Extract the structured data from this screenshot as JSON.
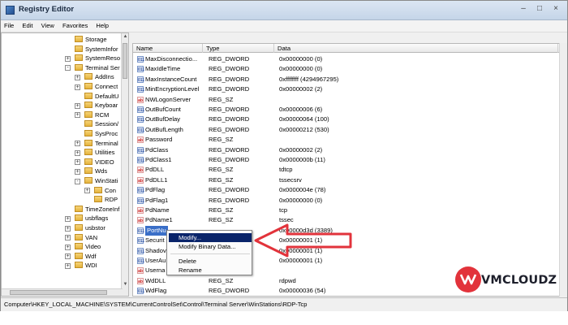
{
  "window": {
    "title": "Registry Editor"
  },
  "menu": [
    "File",
    "Edit",
    "View",
    "Favorites",
    "Help"
  ],
  "tree": [
    {
      "label": "Storage",
      "depth": 3
    },
    {
      "label": "SystemInfor",
      "depth": 3
    },
    {
      "label": "SystemReso",
      "depth": 3,
      "expand": "+"
    },
    {
      "label": "Terminal Ser",
      "depth": 3,
      "expand": "-"
    },
    {
      "label": "AddIns",
      "depth": 4,
      "expand": "+"
    },
    {
      "label": "Connect",
      "depth": 4,
      "expand": "+"
    },
    {
      "label": "DefaultU",
      "depth": 4
    },
    {
      "label": "Keyboar",
      "depth": 4,
      "expand": "+"
    },
    {
      "label": "RCM",
      "depth": 4,
      "expand": "+"
    },
    {
      "label": "Session/",
      "depth": 4
    },
    {
      "label": "SysProc",
      "depth": 4
    },
    {
      "label": "Terminal",
      "depth": 4,
      "expand": "+"
    },
    {
      "label": "Utilities",
      "depth": 4,
      "expand": "+"
    },
    {
      "label": "VIDEO",
      "depth": 4,
      "expand": "+"
    },
    {
      "label": "Wds",
      "depth": 4,
      "expand": "+"
    },
    {
      "label": "WinStati",
      "depth": 4,
      "expand": "-"
    },
    {
      "label": "Con",
      "depth": 5,
      "expand": "+"
    },
    {
      "label": "RDP",
      "depth": 5
    },
    {
      "label": "TimeZoneInf",
      "depth": 3
    },
    {
      "label": "usbflags",
      "depth": 3,
      "expand": "+"
    },
    {
      "label": "usbstor",
      "depth": 3,
      "expand": "+"
    },
    {
      "label": "VAN",
      "depth": 3,
      "expand": "+"
    },
    {
      "label": "Video",
      "depth": 3,
      "expand": "+"
    },
    {
      "label": "Wdf",
      "depth": 3,
      "expand": "+"
    },
    {
      "label": "WDI",
      "depth": 3,
      "expand": "+"
    }
  ],
  "columns": {
    "name": "Name",
    "type": "Type",
    "data": "Data"
  },
  "rows": [
    {
      "name": "MaxDisconnectio...",
      "type": "REG_DWORD",
      "data": "0x00000000 (0)",
      "kind": "dw"
    },
    {
      "name": "MaxIdleTime",
      "type": "REG_DWORD",
      "data": "0x00000000 (0)",
      "kind": "dw"
    },
    {
      "name": "MaxInstanceCount",
      "type": "REG_DWORD",
      "data": "0xffffffff (4294967295)",
      "kind": "dw"
    },
    {
      "name": "MinEncryptionLevel",
      "type": "REG_DWORD",
      "data": "0x00000002 (2)",
      "kind": "dw"
    },
    {
      "name": "NWLogonServer",
      "type": "REG_SZ",
      "data": "",
      "kind": "sz"
    },
    {
      "name": "OutBufCount",
      "type": "REG_DWORD",
      "data": "0x00000006 (6)",
      "kind": "dw"
    },
    {
      "name": "OutBufDelay",
      "type": "REG_DWORD",
      "data": "0x00000064 (100)",
      "kind": "dw"
    },
    {
      "name": "OutBufLength",
      "type": "REG_DWORD",
      "data": "0x00000212 (530)",
      "kind": "dw"
    },
    {
      "name": "Password",
      "type": "REG_SZ",
      "data": "",
      "kind": "sz"
    },
    {
      "name": "PdClass",
      "type": "REG_DWORD",
      "data": "0x00000002 (2)",
      "kind": "dw"
    },
    {
      "name": "PdClass1",
      "type": "REG_DWORD",
      "data": "0x0000000b (11)",
      "kind": "dw"
    },
    {
      "name": "PdDLL",
      "type": "REG_SZ",
      "data": "tdtcp",
      "kind": "sz"
    },
    {
      "name": "PdDLL1",
      "type": "REG_SZ",
      "data": "tssecsrv",
      "kind": "sz"
    },
    {
      "name": "PdFlag",
      "type": "REG_DWORD",
      "data": "0x0000004e (78)",
      "kind": "dw"
    },
    {
      "name": "PdFlag1",
      "type": "REG_DWORD",
      "data": "0x00000000 (0)",
      "kind": "dw"
    },
    {
      "name": "PdName",
      "type": "REG_SZ",
      "data": "tcp",
      "kind": "sz"
    },
    {
      "name": "PdName1",
      "type": "REG_SZ",
      "data": "tssec",
      "kind": "sz"
    },
    {
      "name": "PortNu",
      "type": "",
      "data": "0x00000d3d (3389)",
      "kind": "dw",
      "selected": true
    },
    {
      "name": "Securit",
      "type": "",
      "data": "0x00000001 (1)",
      "kind": "dw"
    },
    {
      "name": "Shadov",
      "type": "",
      "data": "0x00000001 (1)",
      "kind": "dw"
    },
    {
      "name": "UserAu",
      "type": "",
      "data": "0x00000001 (1)",
      "kind": "dw"
    },
    {
      "name": "Userna",
      "type": "",
      "data": "",
      "kind": "sz"
    },
    {
      "name": "WdDLL",
      "type": "REG_SZ",
      "data": "rdpwd",
      "kind": "sz"
    },
    {
      "name": "WdFlag",
      "type": "REG_DWORD",
      "data": "0x00000036 (54)",
      "kind": "dw"
    }
  ],
  "context_menu": {
    "items": [
      "Modify...",
      "Modify Binary Data...",
      "Delete",
      "Rename"
    ],
    "highlighted": "Modify..."
  },
  "status": {
    "path": "Computer\\HKEY_LOCAL_MACHINE\\SYSTEM\\CurrentControlSet\\Control\\Terminal Server\\WinStations\\RDP-Tcp"
  },
  "logo": {
    "text": "VMCLOUDZ"
  },
  "colors": {
    "arrow": "#e2333b",
    "logo_red": "#e2333b",
    "selection": "#0a246a"
  }
}
